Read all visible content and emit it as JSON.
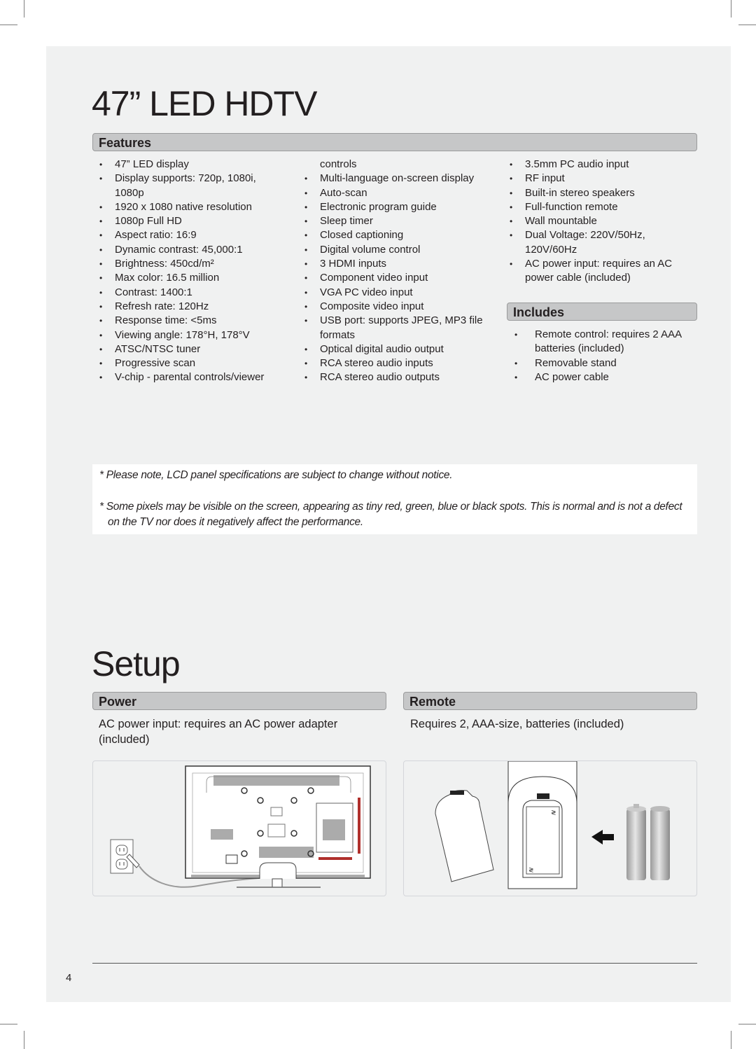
{
  "page": {
    "title": "47” LED HDTV",
    "page_number": "4"
  },
  "features": {
    "header": "Features",
    "col1": [
      {
        "text": "47” LED display"
      },
      {
        "text": "Display supports: 720p, 1080i,"
      },
      {
        "text": "1080p",
        "continuation": true
      },
      {
        "text": "1920 x 1080 native resolution"
      },
      {
        "text": "1080p Full HD"
      },
      {
        "text": "Aspect ratio: 16:9"
      },
      {
        "text": "Dynamic contrast: 45,000:1"
      },
      {
        "text": "Brightness: 450cd/m²"
      },
      {
        "text": "Max color: 16.5 million"
      },
      {
        "text": "Contrast: 1400:1"
      },
      {
        "text": "Refresh rate: 120Hz"
      },
      {
        "text": "Response time: <5ms"
      },
      {
        "text": "Viewing angle: 178°H, 178°V"
      },
      {
        "text": "ATSC/NTSC tuner"
      },
      {
        "text": "Progressive scan"
      },
      {
        "text": "V-chip - parental controls/viewer"
      }
    ],
    "col2": [
      {
        "text": "controls",
        "continuation": true
      },
      {
        "text": "Multi-language on-screen display"
      },
      {
        "text": "Auto-scan"
      },
      {
        "text": "Electronic program guide"
      },
      {
        "text": "Sleep timer"
      },
      {
        "text": "Closed captioning"
      },
      {
        "text": "Digital volume control"
      },
      {
        "text": "3 HDMI inputs"
      },
      {
        "text": "Component video input"
      },
      {
        "text": "VGA PC video input"
      },
      {
        "text": "Composite video input"
      },
      {
        "text": "USB port: supports JPEG, MP3 file"
      },
      {
        "text": "formats",
        "continuation": true
      },
      {
        "text": "Optical digital audio output"
      },
      {
        "text": "RCA stereo audio inputs"
      },
      {
        "text": "RCA stereo audio outputs"
      }
    ],
    "col3": [
      {
        "text": "3.5mm PC audio input"
      },
      {
        "text": "RF input"
      },
      {
        "text": "Built-in stereo speakers"
      },
      {
        "text": "Full-function remote"
      },
      {
        "text": "Wall mountable"
      },
      {
        "text": "Dual Voltage: 220V/50Hz,"
      },
      {
        "text": "120V/60Hz",
        "continuation": true
      },
      {
        "text": "AC power input: requires an AC"
      },
      {
        "text": "power cable (included)",
        "continuation": true
      }
    ]
  },
  "includes": {
    "header": "Includes",
    "items": [
      {
        "text": "Remote control: requires 2 AAA"
      },
      {
        "text": "batteries (included)",
        "continuation": true
      },
      {
        "text": "Removable stand"
      },
      {
        "text": "AC power cable"
      }
    ]
  },
  "bullet_glyph": "•",
  "notes": {
    "note1": "* Please note, LCD panel specifications are subject to change without notice.",
    "note2": "* Some pixels may be visible on the screen, appearing as tiny red, green, blue or black spots. This is normal and is not a defect on the TV nor does it negatively affect the performance."
  },
  "setup": {
    "title": "Setup",
    "power": {
      "header": "Power",
      "text": "AC power input: requires an AC power adapter (included)",
      "figure": "tv-rear-power-connection-illustration"
    },
    "remote": {
      "header": "Remote",
      "text": "Requires 2, AAA-size, batteries (included)",
      "figure": "remote-battery-install-illustration"
    }
  },
  "colors": {
    "panel_bg": "#f0f1f1",
    "header_bg": "#c6c7c8",
    "text": "#231f20",
    "accent_red": "#b0302c"
  }
}
